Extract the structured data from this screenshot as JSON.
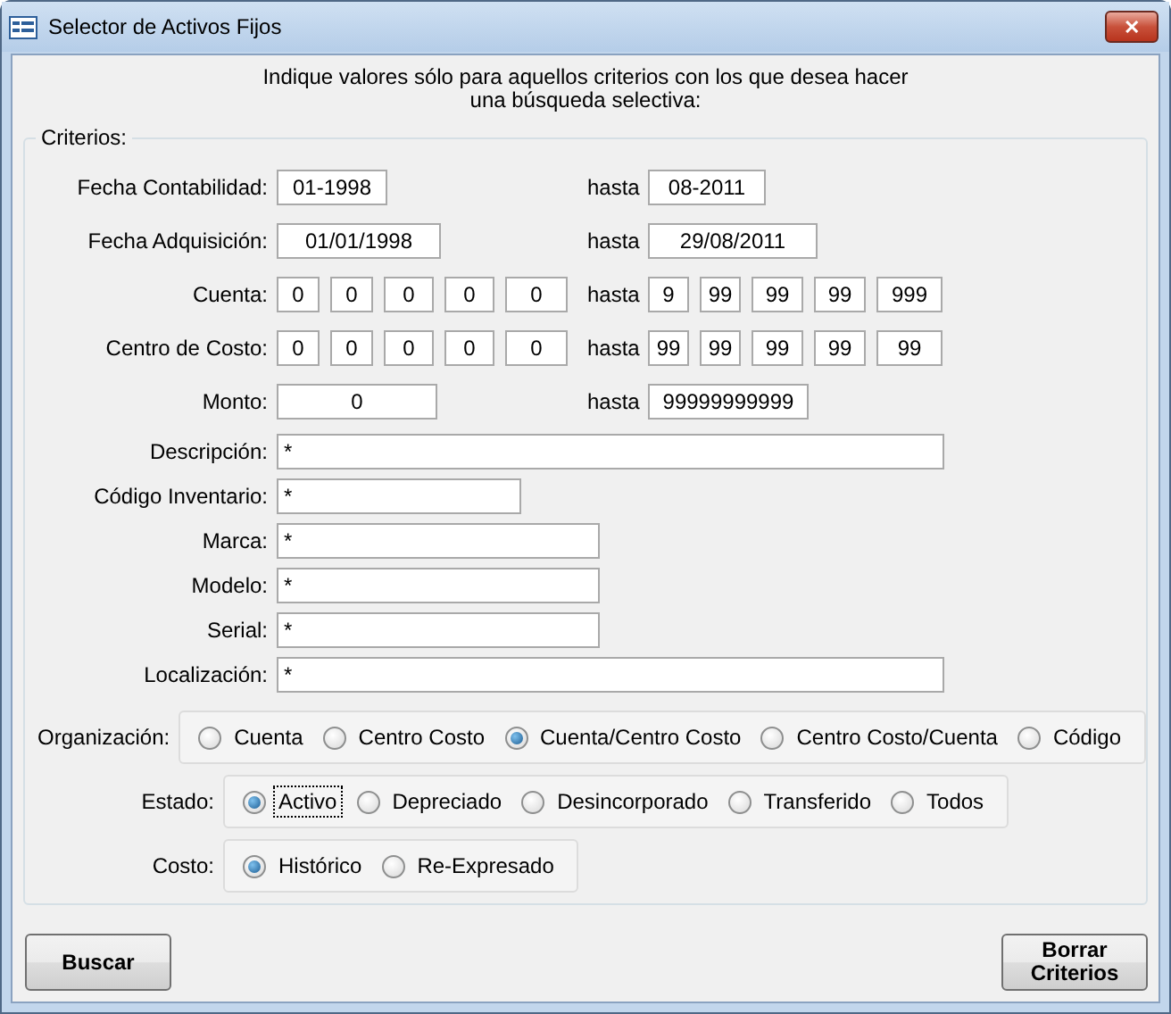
{
  "window": {
    "title": "Selector de Activos Fijos",
    "close": "✕"
  },
  "intro_lines": [
    "Indique valores sólo para aquellos criterios con los que desea hacer",
    "una búsqueda selectiva:"
  ],
  "criteria": {
    "title": "Criterios:",
    "ranges": [
      {
        "label": "Fecha Contabilidad:",
        "from": [
          "01-1998"
        ],
        "separator": "hasta",
        "to": [
          "08-2011"
        ]
      },
      {
        "label": "Fecha Adquisición:",
        "from": [
          "01/01/1998"
        ],
        "separator": "hasta",
        "to": [
          "29/08/2011"
        ]
      },
      {
        "label": "Cuenta:",
        "from": [
          "0",
          "0",
          "0",
          "0",
          "0"
        ],
        "separator": "hasta",
        "to": [
          "9",
          "99",
          "99",
          "99",
          "999"
        ]
      },
      {
        "label": "Centro de Costo:",
        "from": [
          "0",
          "0",
          "0",
          "0",
          "0"
        ],
        "separator": "hasta",
        "to": [
          "99",
          "99",
          "99",
          "99",
          "99"
        ]
      },
      {
        "label": "Monto:",
        "from": [
          "0"
        ],
        "separator": "hasta",
        "to": [
          "99999999999"
        ]
      }
    ],
    "fields": [
      {
        "label": "Descripción:",
        "value": "*",
        "kind": "wide"
      },
      {
        "label": "Código Inventario:",
        "value": "*",
        "kind": "narrow"
      },
      {
        "label": "Marca:",
        "value": "*",
        "kind": "medium"
      },
      {
        "label": "Modelo:",
        "value": "*",
        "kind": "medium"
      },
      {
        "label": "Serial:",
        "value": "*",
        "kind": "medium"
      },
      {
        "label": "Localización:",
        "value": "*",
        "kind": "wide"
      }
    ],
    "option_groups": [
      {
        "label": "Organización:",
        "options": [
          {
            "label": "Cuenta",
            "selected": false,
            "focused": false
          },
          {
            "label": "Centro Costo",
            "selected": false,
            "focused": false
          },
          {
            "label": "Cuenta/Centro Costo",
            "selected": true,
            "focused": false
          },
          {
            "label": "Centro Costo/Cuenta",
            "selected": false,
            "focused": false
          },
          {
            "label": "Código",
            "selected": false,
            "focused": false
          }
        ]
      },
      {
        "label": "Estado:",
        "options": [
          {
            "label": "Activo",
            "selected": true,
            "focused": true
          },
          {
            "label": "Depreciado",
            "selected": false,
            "focused": false
          },
          {
            "label": "Desincorporado",
            "selected": false,
            "focused": false
          },
          {
            "label": "Transferido",
            "selected": false,
            "focused": false
          },
          {
            "label": "Todos",
            "selected": false,
            "focused": false
          }
        ]
      },
      {
        "label": "Costo:",
        "options": [
          {
            "label": "Histórico",
            "selected": true,
            "focused": false
          },
          {
            "label": "Re-Expresado",
            "selected": false,
            "focused": false
          }
        ]
      }
    ]
  },
  "buttons": [
    {
      "label": "Buscar"
    },
    {
      "label": "Borrar Criterios"
    }
  ]
}
